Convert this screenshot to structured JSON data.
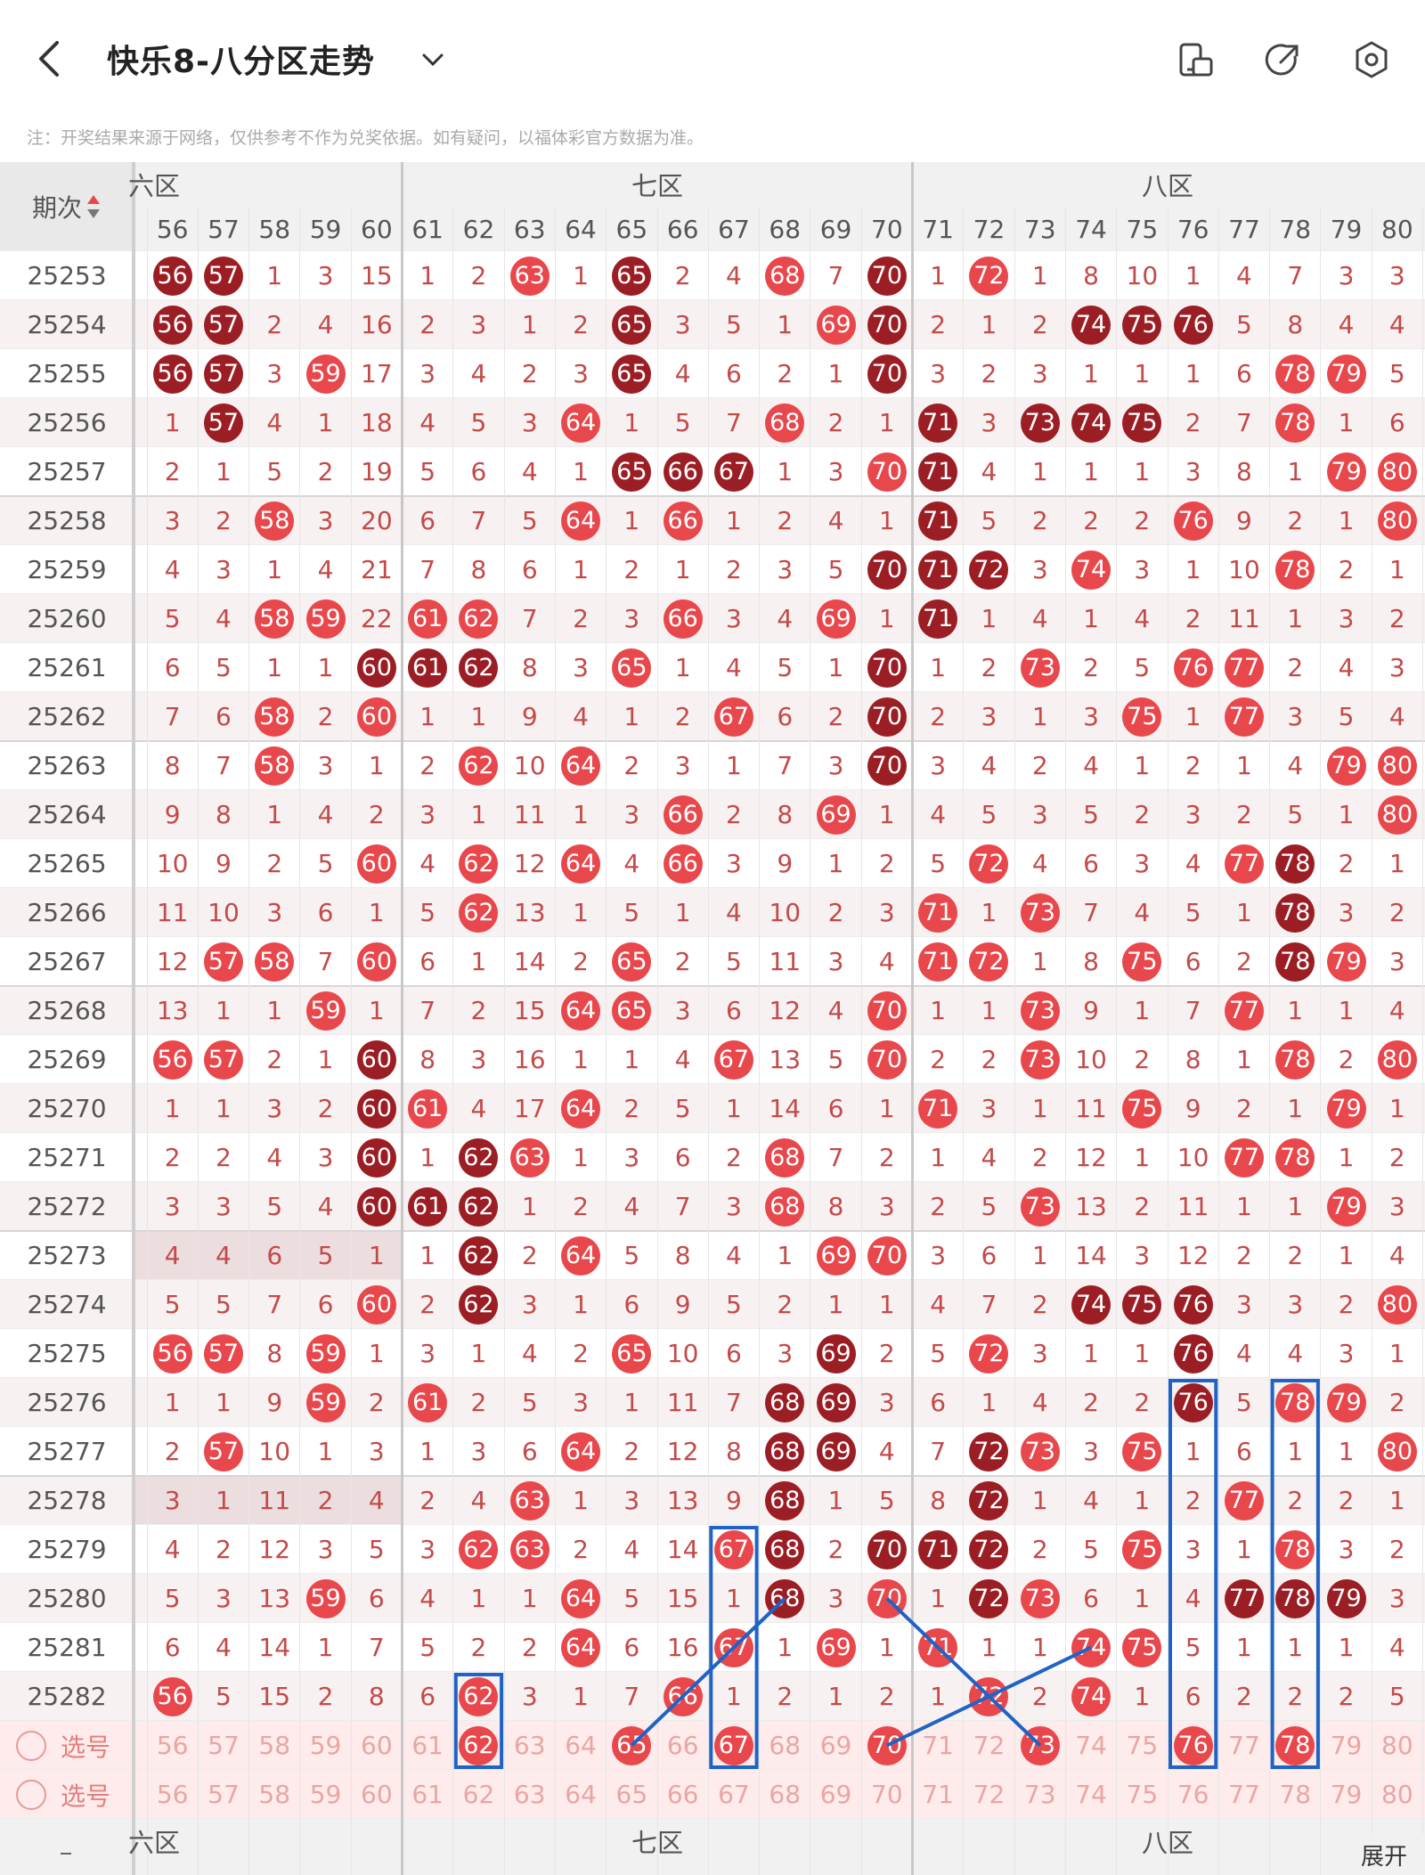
{
  "header": {
    "title": "快乐8-八分区走势",
    "back_icon": "back-chevron-icon",
    "dropdown_icon": "chevron-down-icon",
    "icons": [
      "layout-switch-icon",
      "share-icon",
      "settings-icon"
    ]
  },
  "note": "注：开奖结果来源于网络，仅供参考不作为兑奖依据。如有疑问，以福体彩官方数据为准。",
  "table": {
    "period_header": "期次",
    "zones": [
      "六区",
      "七区",
      "八区"
    ],
    "columns": [
      "56",
      "57",
      "58",
      "59",
      "60",
      "61",
      "62",
      "63",
      "64",
      "65",
      "66",
      "67",
      "68",
      "69",
      "70",
      "71",
      "72",
      "73",
      "74",
      "75",
      "76",
      "77",
      "78",
      "79",
      "80"
    ],
    "rows": [
      {
        "p": "25253",
        "c": [
          "56*",
          "57*",
          "1",
          "3",
          "15",
          "1",
          "2",
          "63",
          "1",
          "65*",
          "2",
          "4",
          "68",
          "7",
          "70*",
          "1",
          "72",
          "1",
          "8",
          "10",
          "1",
          "4",
          "7",
          "3",
          "3"
        ]
      },
      {
        "p": "25254",
        "c": [
          "56*",
          "57*",
          "2",
          "4",
          "16",
          "2",
          "3",
          "1",
          "2",
          "65*",
          "3",
          "5",
          "1",
          "69",
          "70*",
          "2",
          "1",
          "2",
          "74*",
          "75*",
          "76*",
          "5",
          "8",
          "4",
          "4"
        ]
      },
      {
        "p": "25255",
        "c": [
          "56*",
          "57*",
          "3",
          "59",
          "17",
          "3",
          "4",
          "2",
          "3",
          "65*",
          "4",
          "6",
          "2",
          "1",
          "70*",
          "3",
          "2",
          "3",
          "1",
          "1",
          "1",
          "6",
          "78",
          "79",
          "5"
        ]
      },
      {
        "p": "25256",
        "c": [
          "1",
          "57*",
          "4",
          "1",
          "18",
          "4",
          "5",
          "3",
          "64",
          "1",
          "5",
          "7",
          "68",
          "2",
          "1",
          "71*",
          "3",
          "73*",
          "74*",
          "75*",
          "2",
          "7",
          "78",
          "1",
          "6"
        ]
      },
      {
        "p": "25257",
        "c": [
          "2",
          "1",
          "5",
          "2",
          "19",
          "5",
          "6",
          "4",
          "1",
          "65*",
          "66*",
          "67*",
          "1",
          "3",
          "70",
          "71*",
          "4",
          "1",
          "1",
          "1",
          "3",
          "8",
          "1",
          "79",
          "80"
        ]
      },
      {
        "p": "25258",
        "c": [
          "3",
          "2",
          "58",
          "3",
          "20",
          "6",
          "7",
          "5",
          "64",
          "1",
          "66",
          "1",
          "2",
          "4",
          "1",
          "71*",
          "5",
          "2",
          "2",
          "2",
          "76",
          "9",
          "2",
          "1",
          "80"
        ]
      },
      {
        "p": "25259",
        "c": [
          "4",
          "3",
          "1",
          "4",
          "21",
          "7",
          "8",
          "6",
          "1",
          "2",
          "1",
          "2",
          "3",
          "5",
          "70*",
          "71*",
          "72*",
          "3",
          "74",
          "3",
          "1",
          "10",
          "78",
          "2",
          "1"
        ]
      },
      {
        "p": "25260",
        "c": [
          "5",
          "4",
          "58",
          "59",
          "22",
          "61",
          "62",
          "7",
          "2",
          "3",
          "66",
          "3",
          "4",
          "69",
          "1",
          "71*",
          "1",
          "4",
          "1",
          "4",
          "2",
          "11",
          "1",
          "3",
          "2"
        ]
      },
      {
        "p": "25261",
        "c": [
          "6",
          "5",
          "1",
          "1",
          "60*",
          "61*",
          "62*",
          "8",
          "3",
          "65",
          "1",
          "4",
          "5",
          "1",
          "70*",
          "1",
          "2",
          "73",
          "2",
          "5",
          "76",
          "77",
          "2",
          "4",
          "3"
        ]
      },
      {
        "p": "25262",
        "c": [
          "7",
          "6",
          "58",
          "2",
          "60",
          "1",
          "1",
          "9",
          "4",
          "1",
          "2",
          "67",
          "6",
          "2",
          "70*",
          "2",
          "3",
          "1",
          "3",
          "75",
          "1",
          "77",
          "3",
          "5",
          "4"
        ]
      },
      {
        "p": "25263",
        "c": [
          "8",
          "7",
          "58",
          "3",
          "1",
          "2",
          "62",
          "10",
          "64",
          "2",
          "3",
          "1",
          "7",
          "3",
          "70*",
          "3",
          "4",
          "2",
          "4",
          "1",
          "2",
          "1",
          "4",
          "79",
          "80"
        ]
      },
      {
        "p": "25264",
        "c": [
          "9",
          "8",
          "1",
          "4",
          "2",
          "3",
          "1",
          "11",
          "1",
          "3",
          "66",
          "2",
          "8",
          "69",
          "1",
          "4",
          "5",
          "3",
          "5",
          "2",
          "3",
          "2",
          "5",
          "1",
          "80"
        ]
      },
      {
        "p": "25265",
        "c": [
          "10",
          "9",
          "2",
          "5",
          "60",
          "4",
          "62",
          "12",
          "64",
          "4",
          "66",
          "3",
          "9",
          "1",
          "2",
          "5",
          "72",
          "4",
          "6",
          "3",
          "4",
          "77",
          "78*",
          "2",
          "1"
        ]
      },
      {
        "p": "25266",
        "c": [
          "11",
          "10",
          "3",
          "6",
          "1",
          "5",
          "62",
          "13",
          "1",
          "5",
          "1",
          "4",
          "10",
          "2",
          "3",
          "71",
          "1",
          "73",
          "7",
          "4",
          "5",
          "1",
          "78*",
          "3",
          "2"
        ]
      },
      {
        "p": "25267",
        "c": [
          "12",
          "57",
          "58",
          "7",
          "60",
          "6",
          "1",
          "14",
          "2",
          "65",
          "2",
          "5",
          "11",
          "3",
          "4",
          "71",
          "72",
          "1",
          "8",
          "75",
          "6",
          "2",
          "78*",
          "79",
          "3"
        ]
      },
      {
        "p": "25268",
        "c": [
          "13",
          "1",
          "1",
          "59",
          "1",
          "7",
          "2",
          "15",
          "64",
          "65",
          "3",
          "6",
          "12",
          "4",
          "70",
          "1",
          "1",
          "73",
          "9",
          "1",
          "7",
          "77",
          "1",
          "1",
          "4"
        ]
      },
      {
        "p": "25269",
        "c": [
          "56",
          "57",
          "2",
          "1",
          "60*",
          "8",
          "3",
          "16",
          "1",
          "1",
          "4",
          "67",
          "13",
          "5",
          "70",
          "2",
          "2",
          "73",
          "10",
          "2",
          "8",
          "1",
          "78",
          "2",
          "80"
        ]
      },
      {
        "p": "25270",
        "c": [
          "1",
          "1",
          "3",
          "2",
          "60*",
          "61",
          "4",
          "17",
          "64",
          "2",
          "5",
          "1",
          "14",
          "6",
          "1",
          "71",
          "3",
          "1",
          "11",
          "75",
          "9",
          "2",
          "1",
          "79",
          "1"
        ]
      },
      {
        "p": "25271",
        "c": [
          "2",
          "2",
          "4",
          "3",
          "60*",
          "1",
          "62*",
          "63",
          "1",
          "3",
          "6",
          "2",
          "68",
          "7",
          "2",
          "1",
          "4",
          "2",
          "12",
          "1",
          "10",
          "77",
          "78",
          "1",
          "2"
        ]
      },
      {
        "p": "25272",
        "c": [
          "3",
          "3",
          "5",
          "4",
          "60*",
          "61*",
          "62*",
          "1",
          "2",
          "4",
          "7",
          "3",
          "68",
          "8",
          "3",
          "2",
          "5",
          "73",
          "13",
          "2",
          "11",
          "1",
          "1",
          "79",
          "3"
        ]
      },
      {
        "p": "25273",
        "c": [
          "4",
          "4",
          "6",
          "5",
          "1",
          "1",
          "62*",
          "2",
          "64",
          "5",
          "8",
          "4",
          "1",
          "69",
          "70",
          "3",
          "6",
          "1",
          "14",
          "3",
          "12",
          "2",
          "2",
          "1",
          "4"
        ]
      },
      {
        "p": "25274",
        "c": [
          "5",
          "5",
          "7",
          "6",
          "60",
          "2",
          "62*",
          "3",
          "1",
          "6",
          "9",
          "5",
          "2",
          "1",
          "1",
          "4",
          "7",
          "2",
          "74*",
          "75*",
          "76*",
          "3",
          "3",
          "2",
          "80"
        ]
      },
      {
        "p": "25275",
        "c": [
          "56",
          "57",
          "8",
          "59",
          "1",
          "3",
          "1",
          "4",
          "2",
          "65",
          "10",
          "6",
          "3",
          "69*",
          "2",
          "5",
          "72",
          "3",
          "1",
          "1",
          "76*",
          "4",
          "4",
          "3",
          "1"
        ]
      },
      {
        "p": "25276",
        "c": [
          "1",
          "1",
          "9",
          "59",
          "2",
          "61",
          "2",
          "5",
          "3",
          "1",
          "11",
          "7",
          "68*",
          "69*",
          "3",
          "6",
          "1",
          "4",
          "2",
          "2",
          "76*",
          "5",
          "78",
          "79",
          "2"
        ]
      },
      {
        "p": "25277",
        "c": [
          "2",
          "57",
          "10",
          "1",
          "3",
          "1",
          "3",
          "6",
          "64",
          "2",
          "12",
          "8",
          "68*",
          "69*",
          "4",
          "7",
          "72*",
          "73",
          "3",
          "75",
          "1",
          "6",
          "1",
          "1",
          "80"
        ]
      },
      {
        "p": "25278",
        "c": [
          "3",
          "1",
          "11",
          "2",
          "4",
          "2",
          "4",
          "63",
          "1",
          "3",
          "13",
          "9",
          "68*",
          "1",
          "5",
          "8",
          "72*",
          "1",
          "4",
          "1",
          "2",
          "77",
          "2",
          "2",
          "1"
        ]
      },
      {
        "p": "25279",
        "c": [
          "4",
          "2",
          "12",
          "3",
          "5",
          "3",
          "62",
          "63",
          "2",
          "4",
          "14",
          "67",
          "68*",
          "2",
          "70*",
          "71*",
          "72*",
          "2",
          "5",
          "75",
          "3",
          "1",
          "78",
          "3",
          "2"
        ]
      },
      {
        "p": "25280",
        "c": [
          "5",
          "3",
          "13",
          "59",
          "6",
          "4",
          "1",
          "1",
          "64",
          "5",
          "15",
          "1",
          "68*",
          "3",
          "70",
          "1",
          "72*",
          "73",
          "6",
          "1",
          "4",
          "77*",
          "78*",
          "79*",
          "3"
        ]
      },
      {
        "p": "25281",
        "c": [
          "6",
          "4",
          "14",
          "1",
          "7",
          "5",
          "2",
          "2",
          "64",
          "6",
          "16",
          "67",
          "1",
          "69",
          "1",
          "71",
          "1",
          "1",
          "74",
          "75",
          "5",
          "1",
          "1",
          "1",
          "4"
        ]
      },
      {
        "p": "25282",
        "c": [
          "56",
          "5",
          "15",
          "2",
          "8",
          "6",
          "62",
          "3",
          "1",
          "7",
          "66",
          "1",
          "2",
          "1",
          "2",
          "1",
          "72",
          "2",
          "74",
          "1",
          "6",
          "2",
          "2",
          "2",
          "5"
        ]
      }
    ],
    "select_rows": [
      {
        "label": "选号",
        "picked": [
          "62",
          "65",
          "67",
          "70",
          "73",
          "76",
          "78"
        ]
      },
      {
        "label": "选号",
        "picked": []
      }
    ],
    "colors": {
      "ball": "#e8474c",
      "ball_repeat": "#9b1e25",
      "miss_text": "#c44a4a",
      "highlight_box": "#1f63c4"
    }
  },
  "expand_label": "展开"
}
